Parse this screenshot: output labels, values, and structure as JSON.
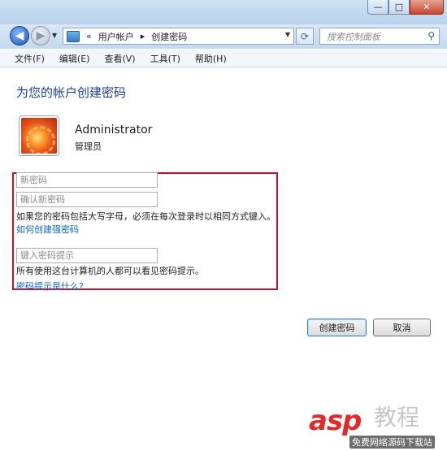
{
  "window": {
    "min_glyph": "—",
    "max_glyph": "□",
    "close_glyph": "✕"
  },
  "address": {
    "overflow": "«",
    "breadcrumb": [
      "用户帐户",
      "创建密码"
    ],
    "separator": "▸"
  },
  "search": {
    "placeholder": "搜索控制面板"
  },
  "menu": [
    {
      "label": "文件(F)"
    },
    {
      "label": "编辑(E)"
    },
    {
      "label": "查看(V)"
    },
    {
      "label": "工具(T)"
    },
    {
      "label": "帮助(H)"
    }
  ],
  "page": {
    "title": "为您的帐户创建密码"
  },
  "user": {
    "name": "Administrator",
    "role": "管理员"
  },
  "form": {
    "new_password_placeholder": "新密码",
    "confirm_password_placeholder": "确认新密码",
    "caps_notice": "如果您的密码包括大写字母，必须在每次登录时以相同方式键入。",
    "strong_password_link": "如何创建强密码",
    "hint_placeholder": "键入密码提示",
    "hint_notice": "所有使用这台计算机的人都可以看见密码提示。",
    "hint_link": "密码提示是什么?"
  },
  "buttons": {
    "create": "创建密码",
    "cancel": "取消"
  },
  "watermark": {
    "brand": "asp",
    "brand_cn": "教程",
    "subtitle": "免费网络源码下载站"
  },
  "colors": {
    "accent_link": "#0a67c7",
    "title_blue": "#1c3f94",
    "highlight_box": "#c8102e"
  }
}
